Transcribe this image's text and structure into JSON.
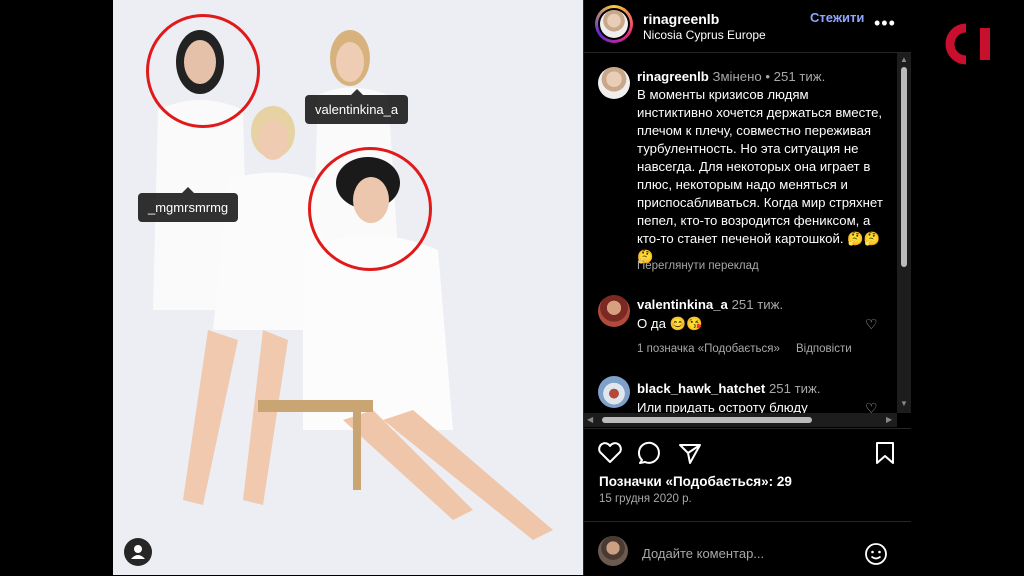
{
  "photo": {
    "tags": [
      "valentinkina_a",
      "_mgmrsmrmg"
    ]
  },
  "post": {
    "username": "rinagreenlb",
    "location": "Nicosia Cyprus Europe",
    "follow_label": "Стежити",
    "more_label": "•••"
  },
  "caption": {
    "username": "rinagreenlb",
    "edited": "Змінено",
    "separator": "•",
    "age": "251 тиж.",
    "text": "В моменты кризисов людям инстиктивно хочется держаться вместе, плечом к плечу, совместно переживая турбулентность. Но эта ситуация не навсегда. Для некоторых она играет в плюс, некоторым надо меняться и приспосабливаться. Когда мир стряхнет пепел, кто-то возродится фениксом, а кто-то станет печеной картошкой. 🤔🤔🤔",
    "translate": "Переглянути переклад"
  },
  "comments": [
    {
      "username": "valentinkina_a",
      "age": "251 тиж.",
      "text": "О да 😊😘",
      "likes": "1 позначка «Подобається»",
      "reply": "Відповісти"
    },
    {
      "username": "black_hawk_hatchet",
      "age": "251 тиж.",
      "text": "Или придать остроту блюду"
    }
  ],
  "stats": {
    "likes_text": "Позначки «Подобається»: 29",
    "date": "15 грудня 2020 р."
  },
  "add_comment": {
    "placeholder": "Додайте коментар..."
  },
  "logo": {
    "text": "CI",
    "color": "#c8102e"
  },
  "icons": [
    "heart-icon",
    "comment-icon",
    "share-icon",
    "bookmark-icon",
    "emoji-icon",
    "user-tag-icon"
  ]
}
